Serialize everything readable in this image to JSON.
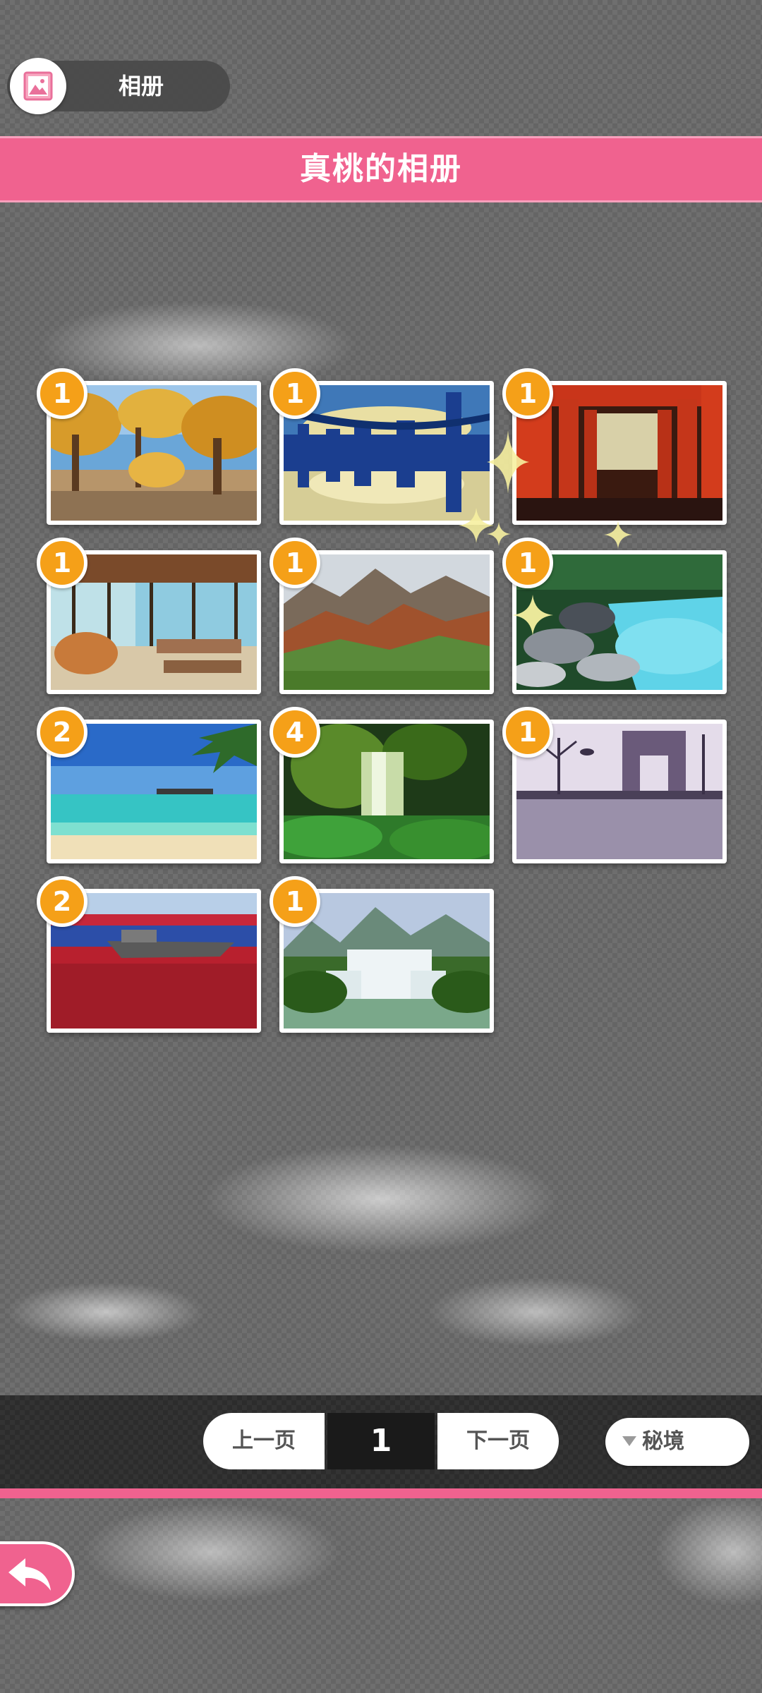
{
  "header": {
    "album_label": "相册",
    "icon": "photo-icon"
  },
  "title": "真桃的相册",
  "album": [
    {
      "count": "1",
      "scene": "autumn-poplar-forest"
    },
    {
      "count": "1",
      "scene": "reflected-city-skyline"
    },
    {
      "count": "1",
      "scene": "red-torii-gates"
    },
    {
      "count": "1",
      "scene": "glass-cafeteria"
    },
    {
      "count": "1",
      "scene": "mountain-valley"
    },
    {
      "count": "1",
      "scene": "turquoise-lake-rocks"
    },
    {
      "count": "2",
      "scene": "tropical-beach"
    },
    {
      "count": "4",
      "scene": "mossy-waterfall"
    },
    {
      "count": "1",
      "scene": "triumphal-arch-street"
    },
    {
      "count": "2",
      "scene": "red-beach-boat"
    },
    {
      "count": "1",
      "scene": "cascading-waterfall"
    }
  ],
  "pager": {
    "prev_label": "上一页",
    "page": "1",
    "next_label": "下一页"
  },
  "filter": {
    "selected": "秘境"
  },
  "back": {
    "icon": "back-arrow-icon"
  },
  "colors": {
    "accent_pink": "#f0628f",
    "badge_orange": "#f5a018",
    "bar_dark": "#2c2c2c"
  }
}
